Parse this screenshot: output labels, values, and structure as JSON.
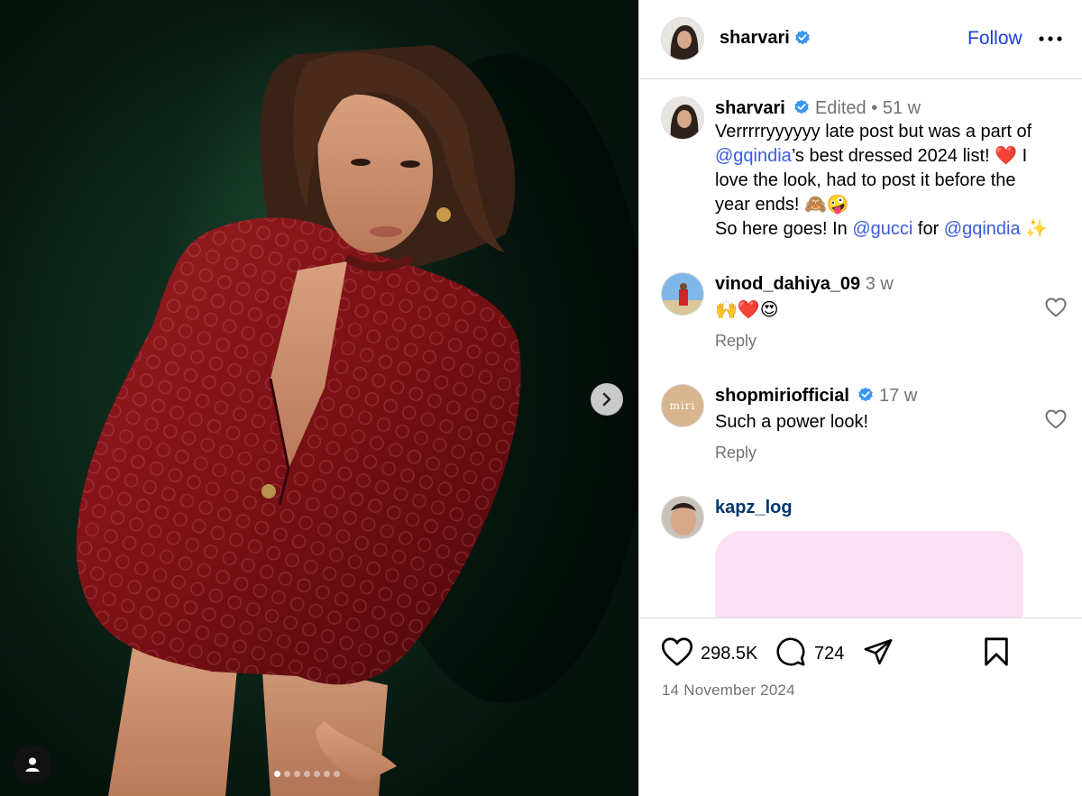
{
  "post": {
    "author": "sharvari",
    "follow_label": "Follow",
    "carousel": {
      "dot_count": 7,
      "active_index": 0
    },
    "likes": "298.5K",
    "comments_count": "724",
    "date": "14 November 2024"
  },
  "caption": {
    "username": "sharvari",
    "edited_label": "Edited",
    "separator": "•",
    "age": "51 w",
    "line1": "Verrrrryyyyyy late post but was a part of",
    "mention1": "@gqindia",
    "line2": "’s best dressed 2024 list! ❤️ I",
    "line3": "love the look, had to post it before the",
    "line4": "year ends! 🙈🤪",
    "line5_prefix": "So here goes! In ",
    "mention2": "@gucci",
    "line5_mid": " for ",
    "mention3": "@gqindia",
    "line5_suffix": " ✨"
  },
  "comments": [
    {
      "username": "vinod_dahiya_09",
      "age": "3 w",
      "text": "🙌❤️😍",
      "reply_label": "Reply"
    },
    {
      "username": "shopmiriofficial",
      "age": "17 w",
      "text": "Such a power look!",
      "reply_label": "Reply",
      "avatar_text": "miri"
    },
    {
      "username": "kapz_log"
    }
  ],
  "colors": {
    "accent_blue": "#1a3fd4",
    "mention_blue": "#3a5be0",
    "verified_blue": "#3897f0",
    "meta_gray": "#737373",
    "jacket_red": "#7a1015",
    "sticker_pink": "#fbdff3"
  },
  "icons": {
    "verified": "verified-badge-icon",
    "more": "more-horizontal-icon",
    "next": "chevron-right-icon",
    "tag": "user-tag-icon",
    "like": "heart-icon",
    "comment": "comment-icon",
    "share": "paper-plane-icon",
    "save": "bookmark-icon"
  }
}
